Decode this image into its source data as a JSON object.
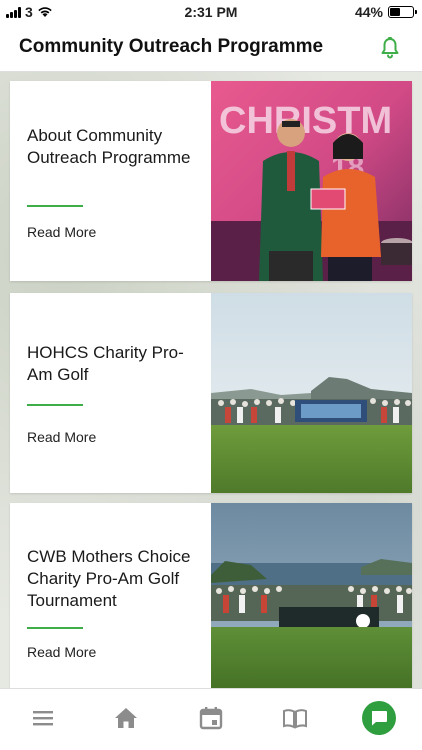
{
  "status_bar": {
    "carrier": "3",
    "time": "2:31 PM",
    "battery": "44%",
    "battery_level": 0.44
  },
  "header": {
    "title": "Community Outreach Programme",
    "notification_icon": "bell-icon"
  },
  "colors": {
    "accent": "#3fae48",
    "chat_button": "#2f9e3e"
  },
  "cards": [
    {
      "title": "About Community Outreach Programme",
      "link": "Read More",
      "image": "christmas-award-photo"
    },
    {
      "title": "HOHCS Charity Pro-Am Golf",
      "link": "Read More",
      "image": "golf-group-photo"
    },
    {
      "title": "CWB Mothers Choice Charity Pro-Am Golf Tournament",
      "link": "Read More",
      "image": "golf-tournament-photo"
    }
  ],
  "bottom_nav": {
    "items": [
      "menu-icon",
      "home-icon",
      "calendar-icon",
      "book-icon",
      "chat-icon"
    ]
  }
}
